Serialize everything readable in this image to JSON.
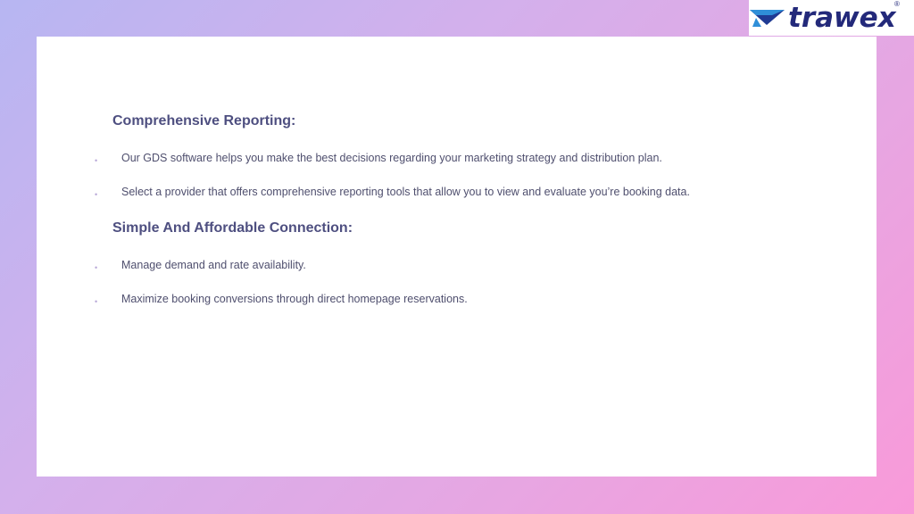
{
  "logo": {
    "text": "trawex",
    "registered": "®",
    "colors": {
      "text": "#23297a",
      "mark_primary": "#1f3a93",
      "mark_accent": "#2f8fd8"
    }
  },
  "sections": [
    {
      "heading": "Comprehensive Reporting:",
      "bullets": [
        "Our GDS software helps you make the best decisions regarding your marketing strategy and distribution plan.",
        "Select a provider that offers comprehensive reporting tools that allow you to view and evaluate you’re booking data."
      ]
    },
    {
      "heading": "Simple And Affordable Connection:",
      "bullets": [
        "Manage demand and rate availability.",
        "Maximize booking conversions through direct homepage reservations."
      ]
    }
  ],
  "bullet_symbol": "•",
  "colors": {
    "heading": "#4e4f80",
    "body_text": "#4f4f6e",
    "bullet": "#b9a9d8",
    "card": "#ffffff"
  }
}
